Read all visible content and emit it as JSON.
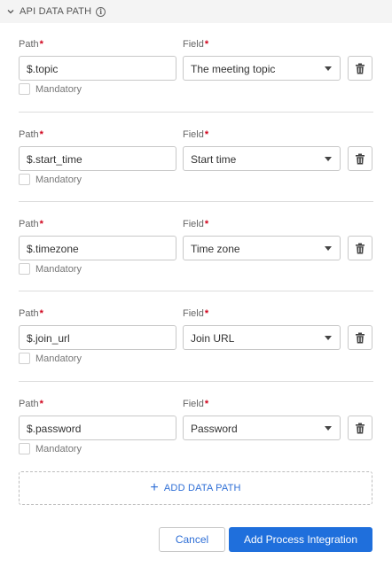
{
  "section": {
    "title": "API DATA PATH",
    "info_glyph": "i"
  },
  "labels": {
    "path": "Path",
    "field": "Field",
    "required_mark": "*",
    "mandatory": "Mandatory"
  },
  "rows": [
    {
      "path": "$.topic",
      "field": "The meeting topic",
      "mandatory": false
    },
    {
      "path": "$.start_time",
      "field": "Start time",
      "mandatory": false
    },
    {
      "path": "$.timezone",
      "field": "Time zone",
      "mandatory": false
    },
    {
      "path": "$.join_url",
      "field": "Join URL",
      "mandatory": false
    },
    {
      "path": "$.password",
      "field": "Password",
      "mandatory": false
    }
  ],
  "add_path": {
    "plus": "+",
    "label": "ADD DATA PATH"
  },
  "footer": {
    "cancel_label": "Cancel",
    "submit_label": "Add Process Integration"
  },
  "colors": {
    "accent": "#1f6fdc",
    "required": "#d0021b"
  },
  "icons": {
    "collapse": "chevron-down-icon",
    "info": "info-icon",
    "delete": "trash-icon",
    "dropdown": "caret-down-icon"
  }
}
